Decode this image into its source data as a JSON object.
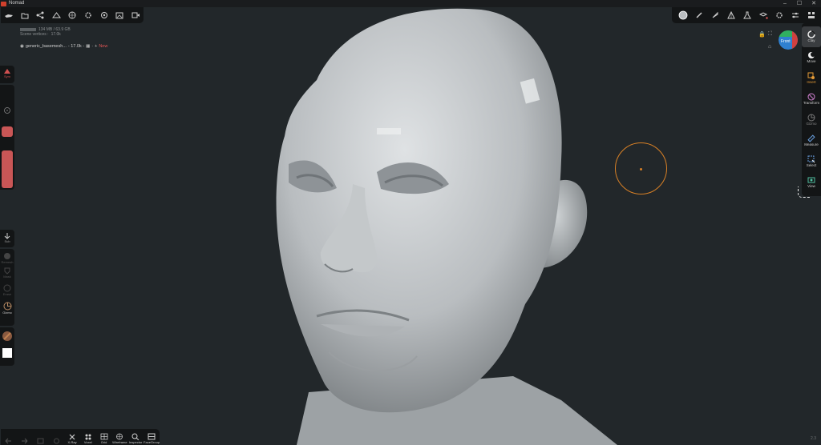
{
  "window": {
    "title": "Nomad",
    "controls": [
      "–",
      "☐",
      "✕"
    ]
  },
  "topbar_left": {
    "icons": [
      "tools-icon",
      "folder-icon",
      "share-icon",
      "scene-icon",
      "globe-icon",
      "gear-icon",
      "settings-icon",
      "image-icon",
      "video-icon"
    ]
  },
  "topbar_right": {
    "icons": [
      "material-icon",
      "brush-icon",
      "pen-icon",
      "vertex-icon",
      "flask-icon",
      "layers-icon",
      "gear-icon",
      "sliders-icon",
      "stack-icon"
    ]
  },
  "info": {
    "memory": "134 MB / 63.9 GB",
    "vertices_label": "Scene vertices :",
    "vertices_value": "17.0k"
  },
  "mesh": {
    "name": "generic_basemesh...",
    "count": "- 17.0k -",
    "tag": "New"
  },
  "left_panel": {
    "sym_label": "Sym",
    "sub_label": "Sub",
    "disabled_1": "Remesh",
    "disabled_2": "Mask",
    "disabled_3": "Erase",
    "gizmo_label": "Gizmo"
  },
  "right_tools": [
    {
      "label": "Clay",
      "name": "tool-clay",
      "active": true
    },
    {
      "label": "Move",
      "name": "tool-move"
    },
    {
      "label": "Insert",
      "name": "tool-insert",
      "accent": "orange"
    },
    {
      "label": "Transform",
      "name": "tool-transform"
    },
    {
      "label": "Gizmo",
      "name": "tool-gizmo",
      "dim": true
    },
    {
      "label": "Measure",
      "name": "tool-measure"
    },
    {
      "label": "Select",
      "name": "tool-select"
    },
    {
      "label": "View",
      "name": "tool-view"
    }
  ],
  "navcube": {
    "face_label": "Front"
  },
  "bottom_bar": [
    {
      "label": "",
      "name": "undo-button",
      "dim": true
    },
    {
      "label": "",
      "name": "redo-button",
      "dim": true
    },
    {
      "label": "",
      "name": "history-button",
      "dim": true
    },
    {
      "label": "",
      "name": "disabled-button",
      "dim": true
    },
    {
      "label": "X-Ray",
      "name": "xray-button"
    },
    {
      "label": "Voxel",
      "name": "voxel-button"
    },
    {
      "label": "Grid",
      "name": "grid-button"
    },
    {
      "label": "Wireframe",
      "name": "wireframe-button"
    },
    {
      "label": "Inspector",
      "name": "inspector-button"
    },
    {
      "label": "FaceGroup",
      "name": "facegroup-button"
    }
  ],
  "version": "2.3",
  "colors": {
    "accent_red": "#c95656",
    "brush_orange": "#d98126",
    "panel_bg": "#131516",
    "viewport_bg": "#22272a"
  }
}
